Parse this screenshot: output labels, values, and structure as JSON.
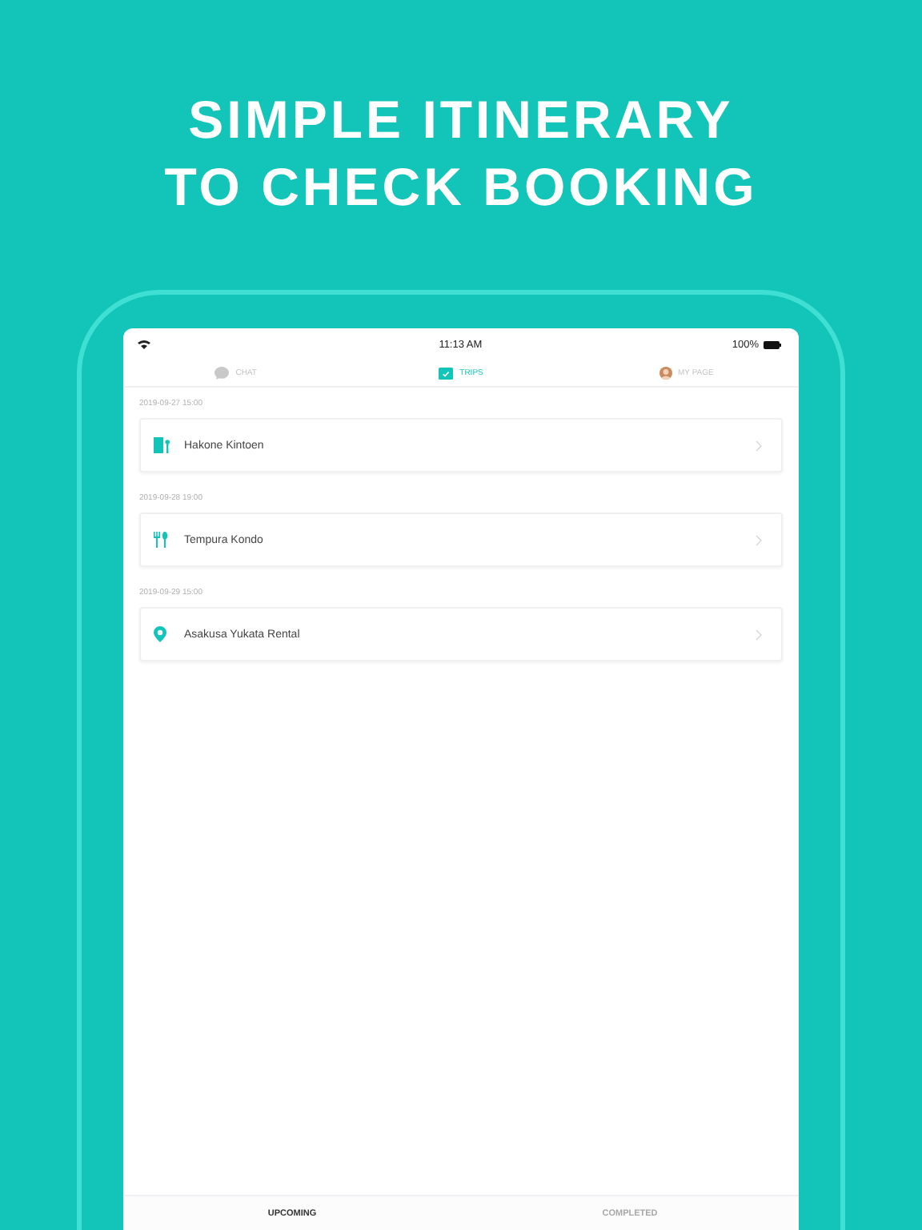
{
  "headline": [
    "SIMPLE ITINERARY",
    "TO CHECK BOOKING"
  ],
  "status_bar": {
    "time": "11:13 AM",
    "battery": "100%"
  },
  "tabs": [
    {
      "label": "CHAT",
      "kind": "chat",
      "selected": false
    },
    {
      "label": "TRIPS",
      "kind": "trips",
      "selected": true
    },
    {
      "label": "MY PAGE",
      "kind": "profile",
      "selected": false
    }
  ],
  "bookings": [
    {
      "date": "2019-09-27 15:00",
      "name": "Hakone Kintoen",
      "kind": "hotel"
    },
    {
      "date": "2019-09-28 19:00",
      "name": "Tempura Kondo",
      "kind": "restaurant"
    },
    {
      "date": "2019-09-29 15:00",
      "name": "Asakusa Yukata Rental",
      "kind": "place"
    }
  ],
  "bottom_tabs": [
    {
      "label": "UPCOMING",
      "selected": true
    },
    {
      "label": "COMPLETED",
      "selected": false
    }
  ]
}
